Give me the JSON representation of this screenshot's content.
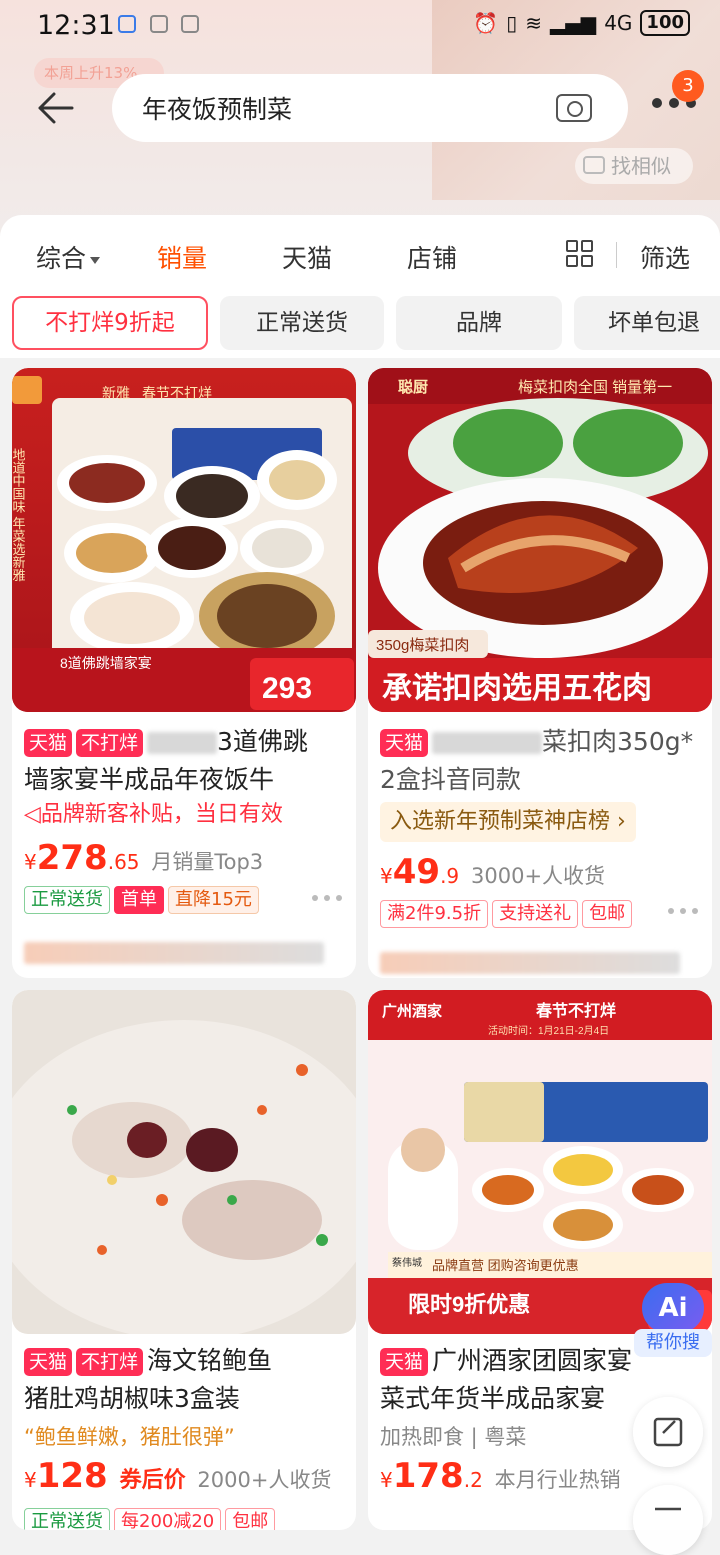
{
  "status_bar": {
    "time": "12:31",
    "battery": "100",
    "network": "4G"
  },
  "ghost": {
    "promo_pill": "本周上升13%",
    "find_similar": "找相似"
  },
  "search": {
    "query": "年夜饭预制菜",
    "notification_count": "3"
  },
  "sort_tabs": [
    "综合",
    "销量",
    "天猫",
    "店铺"
  ],
  "sort_active": "销量",
  "filter_label": "筛选",
  "chips": [
    "不打烊9折起",
    "正常送货",
    "品牌",
    "坏单包退"
  ],
  "products": [
    {
      "image_text": {
        "brand": "新雅",
        "banner": "春节不打烊",
        "side": "地道中国味 年菜选新雅",
        "bottom": "8道佛跳墙家宴",
        "price": "293"
      },
      "tags": [
        "天猫",
        "不打烊"
      ],
      "title_suffix": "3道佛跳",
      "title_line2": "墙家宴半成品年夜饭牛",
      "subsidy": "品牌新客补贴，当日有效",
      "price_int": "278",
      "price_dec": ".65",
      "meta": "月销量Top3",
      "service_tags": [
        "正常送货",
        "首单",
        "直降15元"
      ]
    },
    {
      "image_text": {
        "brand": "聪厨",
        "banner": "梅菜扣肉全国 销量第一",
        "weight": "350g梅菜扣肉",
        "slogan": "承诺扣肉选用五花肉"
      },
      "tags": [
        "天猫"
      ],
      "title_suffix": "菜扣肉350g*",
      "title_line2": "2盒抖音同款",
      "rank": "入选新年预制菜神店榜 ›",
      "price_int": "49",
      "price_dec": ".9",
      "meta": "3000+人收货",
      "service_tags": [
        "满2件9.5折",
        "支持送礼",
        "包邮"
      ]
    },
    {
      "tags": [
        "天猫",
        "不打烊"
      ],
      "title_suffix": "海文铭鲍鱼",
      "title_line2": "猪肚鸡胡椒味3盒装",
      "quote": "“鲍鱼鲜嫩，猪肚很弹”",
      "price_int": "128",
      "coupon_label": "券后价",
      "meta": "2000+人收货",
      "service_tags": [
        "正常送货",
        "每200减20",
        "包邮"
      ]
    },
    {
      "image_text": {
        "brand": "广州酒家",
        "banner": "春节不打烊",
        "date": "活动时间：1月21日-2月4日",
        "chef": "蔡伟城",
        "notice": "品牌直营 团购咨询更优惠",
        "sale": "限时9折优惠"
      },
      "tags": [
        "天猫"
      ],
      "title_suffix": "广州酒家团圆家宴",
      "title_line2": "菜式年货半成品家宴",
      "attrs": "加热即食 | 粤菜",
      "price_int": "178",
      "price_dec": ".2",
      "meta": "本月行业热销"
    }
  ],
  "ai_helper": {
    "icon": "Ai",
    "label": "帮你搜"
  },
  "colors": {
    "accent": "#ff5000",
    "tmall": "#ff2d55",
    "price": "#ff2e16"
  }
}
